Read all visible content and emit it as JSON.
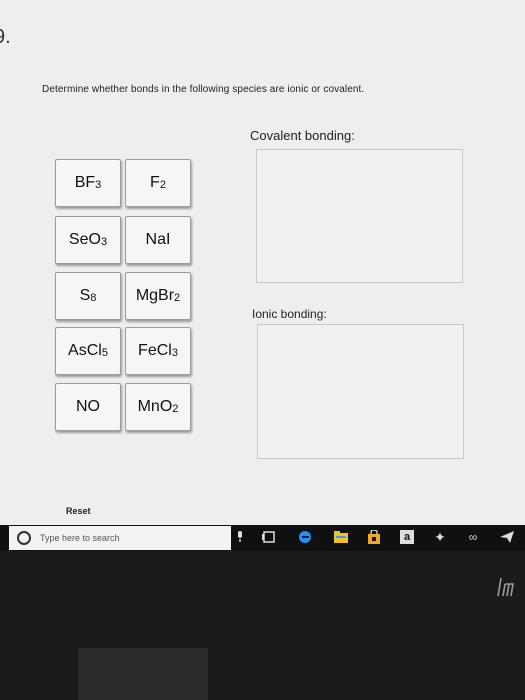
{
  "question": {
    "number": "9.",
    "prompt": "Determine whether bonds in the following species are ionic or covalent."
  },
  "zones": {
    "covalent_label": "Covalent bonding:",
    "ionic_label": "Ionic bonding:"
  },
  "chips": [
    {
      "base": "BF",
      "sub": "3"
    },
    {
      "base": "F",
      "sub": "2"
    },
    {
      "base": "SeO",
      "sub": "3"
    },
    {
      "base": "NaI",
      "sub": ""
    },
    {
      "base": "S",
      "sub": "8"
    },
    {
      "base": "MgBr",
      "sub": "2"
    },
    {
      "base": "AsCl",
      "sub": "5"
    },
    {
      "base": "FeCl",
      "sub": "3"
    },
    {
      "base": "NO",
      "sub": ""
    },
    {
      "base": "MnO",
      "sub": "2"
    }
  ],
  "reset_label": "Reset",
  "taskbar": {
    "search_placeholder": "Type here to search",
    "amazon_letter": "a"
  },
  "colors": {
    "edge_blue": "#1e90ff",
    "store_orange": "#f5a623",
    "taskbar_bg": "#101010"
  }
}
